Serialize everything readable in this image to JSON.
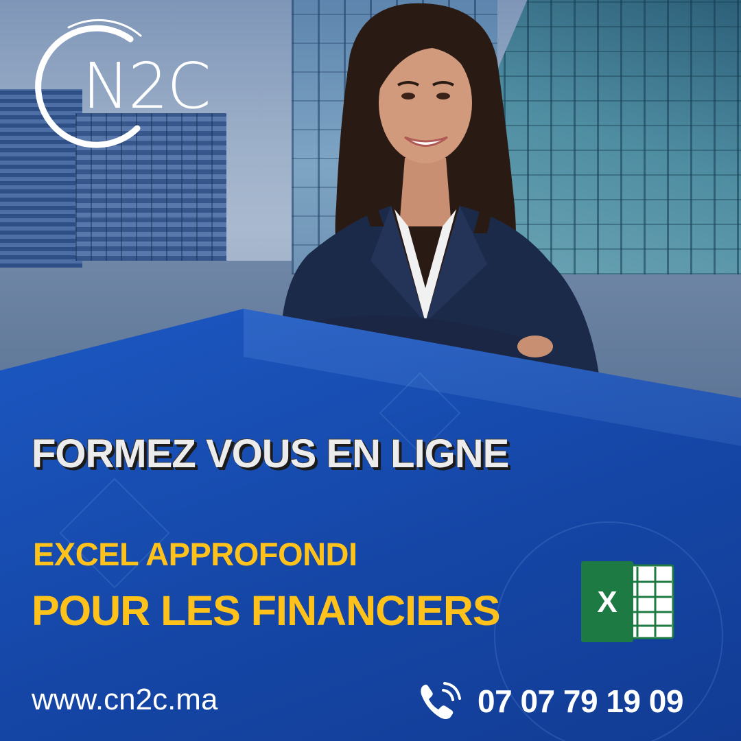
{
  "logo": {
    "text": "N2C"
  },
  "headline": "FORMEZ VOUS EN LIGNE",
  "course": {
    "line1": "EXCEL APPROFONDI",
    "line2": "POUR LES FINANCIERS",
    "icon": "excel-icon"
  },
  "contact": {
    "website": "www.cn2c.ma",
    "phone": "07 07 79 19 09",
    "phone_icon": "phone-icon"
  },
  "colors": {
    "accent_yellow": "#ffc21a",
    "panel_blue": "#1b56bf",
    "excel_green": "#1d7a43"
  }
}
